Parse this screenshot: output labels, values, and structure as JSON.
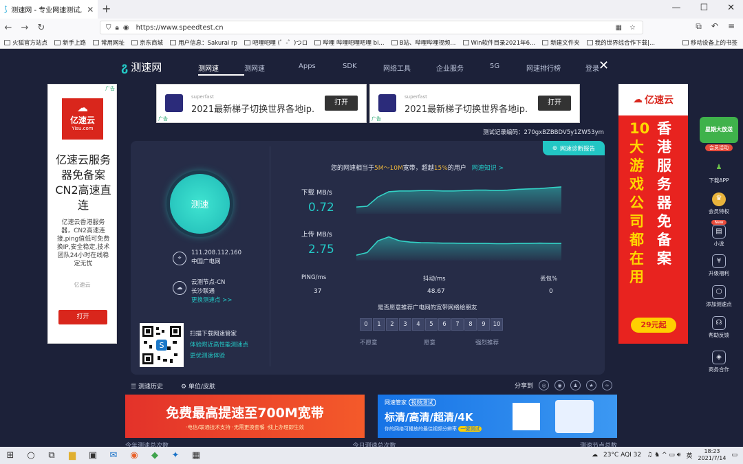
{
  "browser": {
    "tab_title": "测速网 - 专业网速测试, 宽带测速",
    "url": "https://www.speedtest.cn",
    "bookmarks": [
      "火狐官方站点",
      "新手上路",
      "常用网址",
      "京东商城",
      "用户信息：Sakurai rp",
      "吧哩吧哩 (゜-゜)つロ",
      "哔哩 哔哩吧哩吧哩 bi...",
      "B站、哔哩哔哩视频...",
      "Win软件目录2021年6...",
      "新建文件夹",
      "我的世界综合作下载|..."
    ],
    "bookmarks_right": "移动设备上的书签"
  },
  "site": {
    "logo": "测速网",
    "nav": [
      "测网速",
      "测网速",
      "Apps",
      "SDK",
      "网络工具",
      "企业服务",
      "5G",
      "网速排行榜",
      "登录"
    ],
    "active_nav": 0
  },
  "banners": [
    {
      "small": "superfast",
      "text": "2021最新梯子切换世界各地ip.",
      "btn": "打开",
      "ad": "广告"
    },
    {
      "small": "superfast",
      "text": "2021最新梯子切换世界各地ip.",
      "btn": "打开",
      "ad": "广告"
    }
  ],
  "test": {
    "test_id_label": "测试记录编码：",
    "test_id": "270gxBZBBDV5y1ZW53ym",
    "report_btn": "网速诊断报告",
    "gauge_label": "测速",
    "ip": "111.208.112.160",
    "isp": "中国广电网",
    "node_label": "云测节点-CN",
    "node_sub": "长沙联通",
    "change_node": "更换测速点 >>",
    "qr_title": "扫描下载网速管家",
    "qr_line1": "体验附近高性能测速点",
    "qr_line2": "更优测速体验",
    "summary_pre": "您的网速相当于",
    "summary_range": "5M～10M",
    "summary_mid": "宽带，超越",
    "summary_pct": "15%",
    "summary_post": "的用户",
    "summary_link": "网速知识 >",
    "download_label": "下载 MB/s",
    "download_value": "0.72",
    "upload_label": "上传 MB/s",
    "upload_value": "2.75",
    "ping_label": "PING/ms",
    "ping_value": "37",
    "jitter_label": "抖动/ms",
    "jitter_value": "48.67",
    "loss_label": "丢包%",
    "loss_value": "0",
    "recommend_q": "是否愿意推荐广电网的宽带网络给朋友",
    "rating": [
      "0",
      "1",
      "2",
      "3",
      "4",
      "5",
      "6",
      "7",
      "8",
      "9",
      "10"
    ],
    "rate_low": "不愿意",
    "rate_mid": "愿意",
    "rate_high": "强烈推荐"
  },
  "tools": {
    "history": "测速历史",
    "units": "单位/皮肤",
    "share": "分享到"
  },
  "bottom_ads": {
    "red_text": "免费最高提速至700M宽带",
    "red_sub": "·电信/联通技术支持  ·无需更换套餐  ·线上办理即生效",
    "blue_brand": "网速管家",
    "blue_tag": "视频测试",
    "blue_text": "标清/高清/超清/4K",
    "blue_sub": "你的网络可播放的最佳视频分辨率",
    "blue_btn": "一键测试"
  },
  "counts": [
    "今年测速总次数",
    "今日测速总次数",
    "测速节点总数"
  ],
  "left_ad": {
    "brand": "亿速云",
    "brand_en": "Yisu.com",
    "title": "亿速云服务器免备案CN2高速直连",
    "desc": "亿速云香港服务器，CN2高速连接,ping值低可免费换IP,安全稳定,技术团队24小时在线稳定无忧",
    "source": "亿速云",
    "btn": "打开",
    "ad": "广告"
  },
  "right_ad": {
    "brand": "亿速云",
    "left_col": "10大游戏公司都在用",
    "right_col": "香港服务器免备案",
    "price": "29元起"
  },
  "sidebar": {
    "promo": "星期大放送",
    "promo_sub": "会员活动",
    "items": [
      "下载APP",
      "会员特权",
      "小说",
      "升级福利",
      "添加测速点",
      "帮助反馈",
      "商务合作"
    ],
    "new_badge": "New"
  },
  "taskbar": {
    "weather": "23°C  AQI 32",
    "ime": "英",
    "time": "18:23",
    "date": "2021/7/14"
  },
  "chart_data": [
    {
      "type": "area",
      "series": [
        {
          "name": "下载",
          "values": [
            0.3,
            0.32,
            0.55,
            0.68,
            0.7,
            0.7,
            0.71,
            0.71,
            0.7,
            0.7,
            0.71,
            0.72,
            0.72,
            0.71,
            0.72,
            0.74,
            0.75,
            0.76,
            0.78,
            0.8
          ]
        }
      ]
    },
    {
      "type": "area",
      "series": [
        {
          "name": "上传",
          "values": [
            2.3,
            2.4,
            2.85,
            3.0,
            2.85,
            2.8,
            2.78,
            2.77,
            2.76,
            2.76,
            2.75,
            2.75,
            2.75,
            2.74,
            2.74,
            2.75,
            2.75,
            2.76,
            2.75,
            2.75
          ]
        }
      ]
    }
  ]
}
